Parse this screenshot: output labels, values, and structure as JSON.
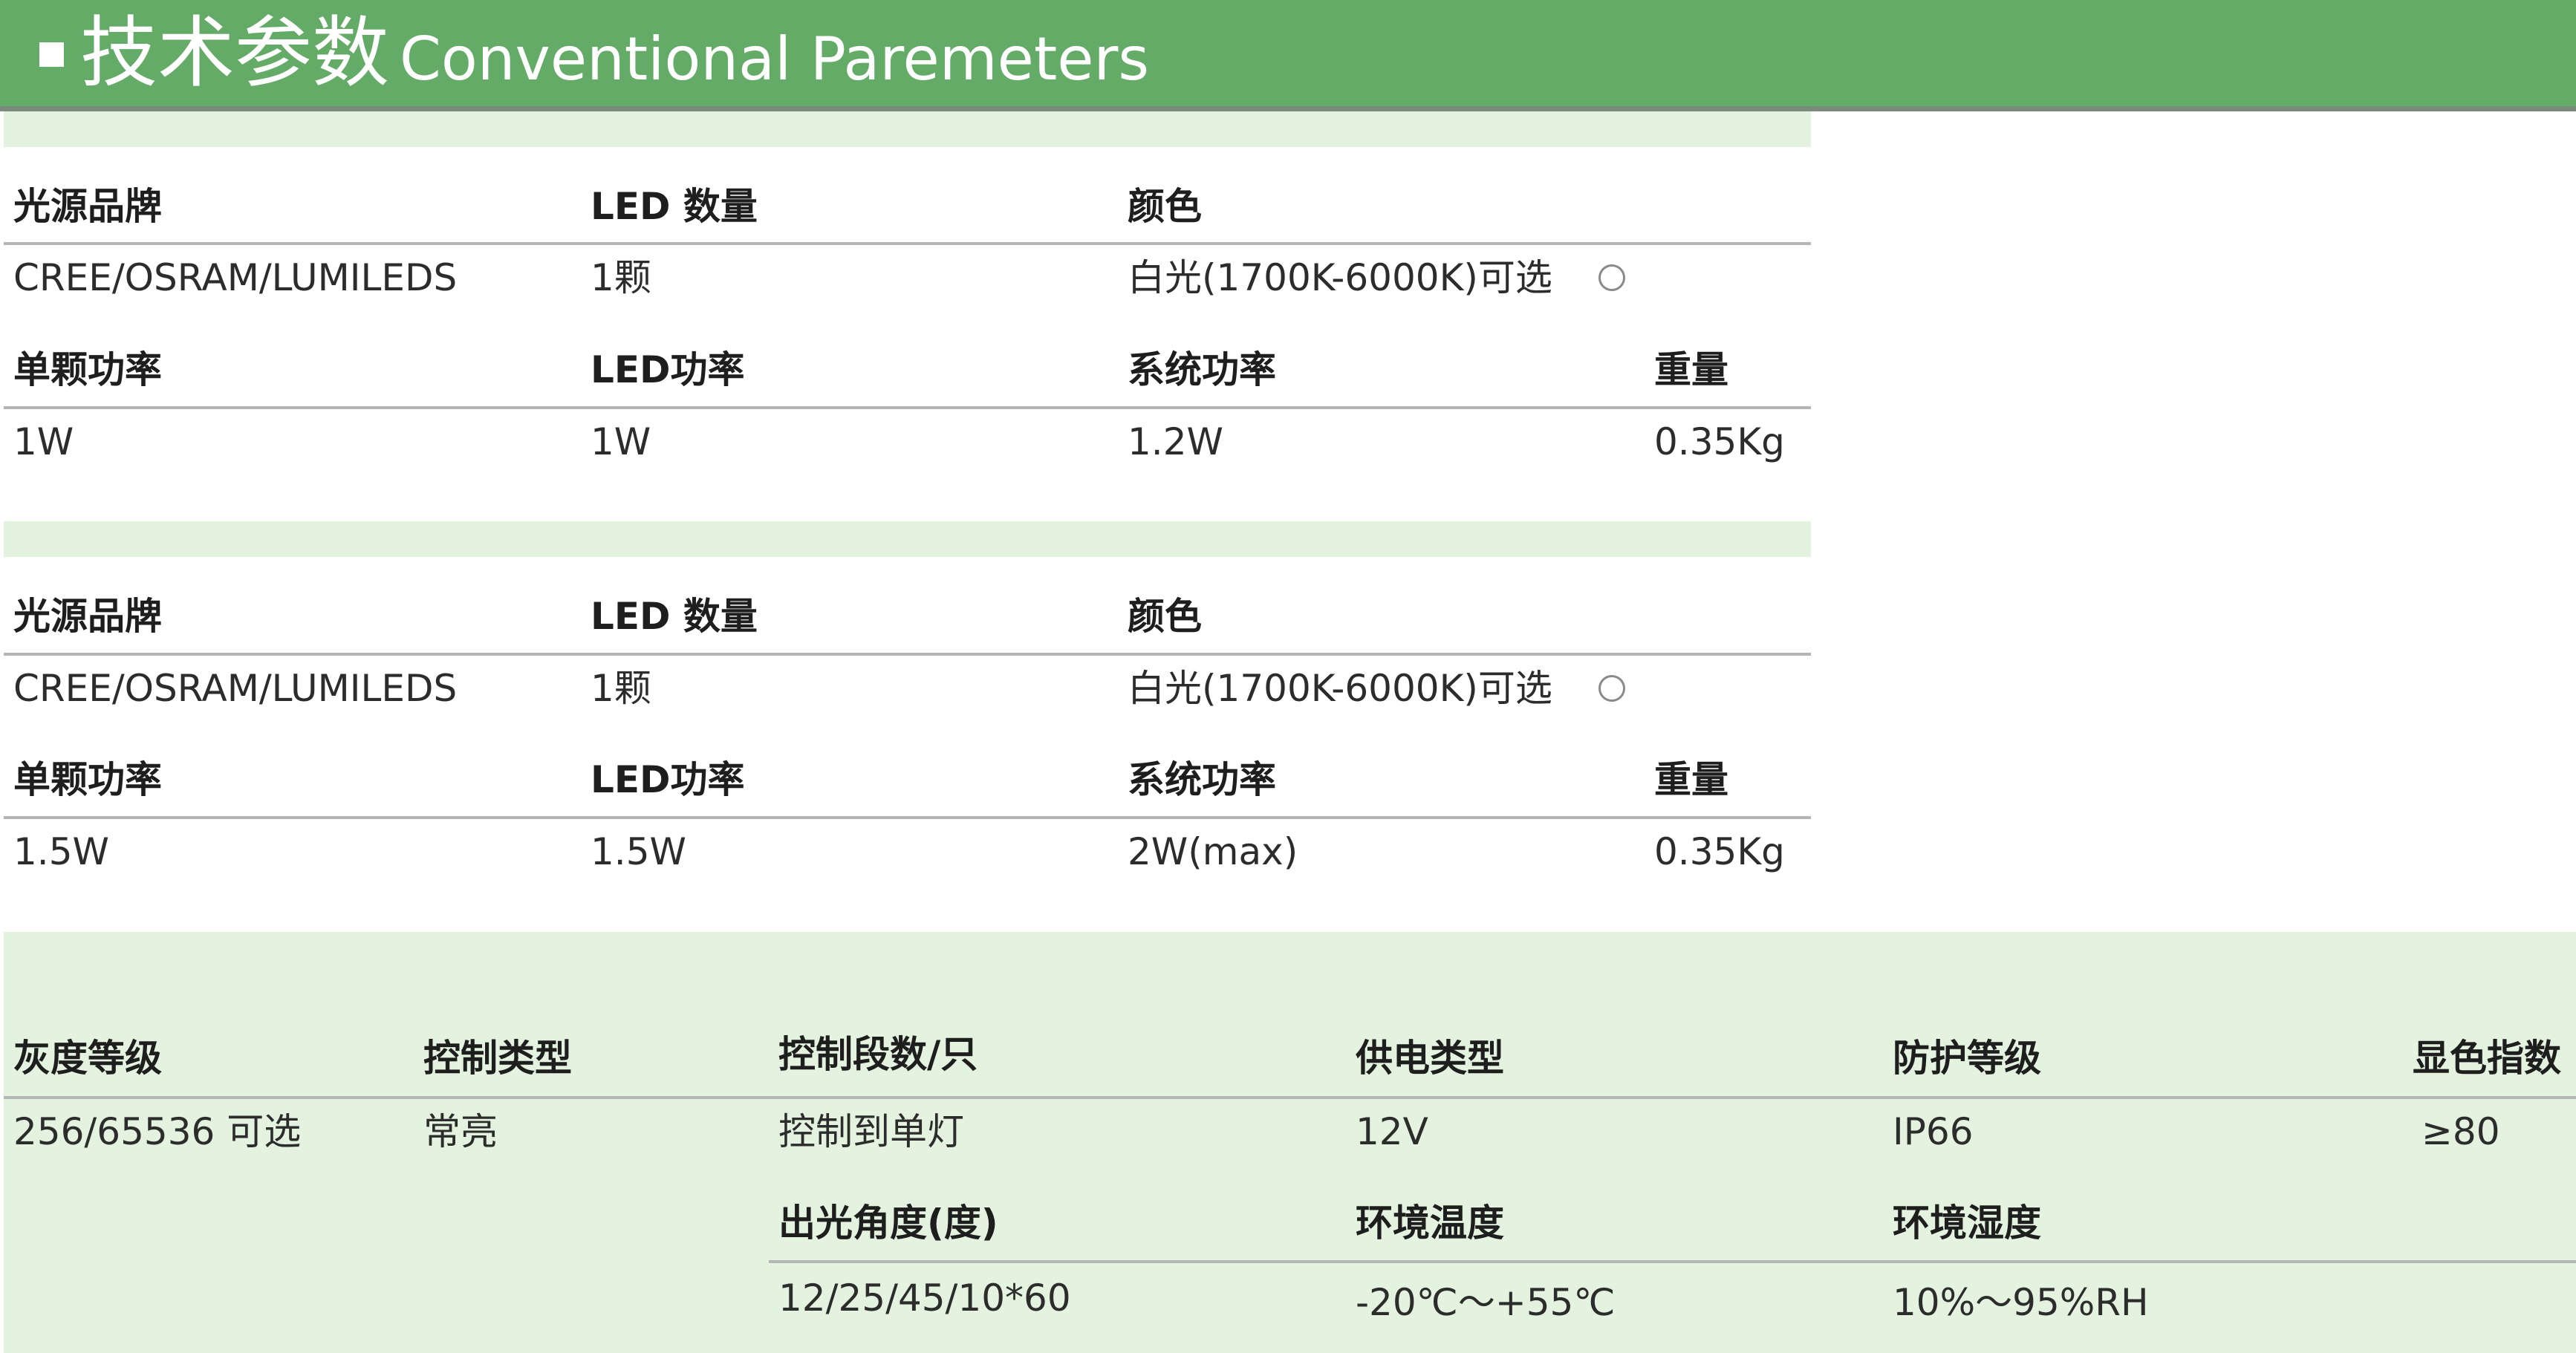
{
  "header": {
    "title_cn": "技术参数",
    "title_en": "Conventional Paremeters"
  },
  "group1": {
    "labels_row1": [
      "光源品牌",
      "LED 数量",
      "颜色"
    ],
    "values_row1": [
      "CREE/OSRAM/LUMILEDS",
      "1颗",
      "白光(1700K-6000K)可选"
    ],
    "labels_row2": [
      "单颗功率",
      "LED功率",
      "系统功率",
      "重量"
    ],
    "values_row2": [
      "1W",
      "1W",
      "1.2W",
      "0.35Kg"
    ]
  },
  "group2": {
    "labels_row1": [
      "光源品牌",
      "LED 数量",
      "颜色"
    ],
    "values_row1": [
      "CREE/OSRAM/LUMILEDS",
      "1颗",
      "白光(1700K-6000K)可选"
    ],
    "labels_row2": [
      "单颗功率",
      "LED功率",
      "系统功率",
      "重量"
    ],
    "values_row2": [
      "1.5W",
      "1.5W",
      "2W(max)",
      "0.35Kg"
    ]
  },
  "group3": {
    "labels_row1": [
      "灰度等级",
      "控制类型",
      "控制段数/只",
      "供电类型",
      "防护等级",
      "显色指数"
    ],
    "values_row1": [
      "256/65536 可选",
      "常亮",
      "控制到单灯",
      "12V",
      "IP66",
      "≥80"
    ],
    "labels_row2": [
      "出光角度(度)",
      "环境温度",
      "环境湿度"
    ],
    "values_row2": [
      "12/25/45/10*60",
      "-20℃～+55℃",
      "10%～95%RH"
    ]
  }
}
